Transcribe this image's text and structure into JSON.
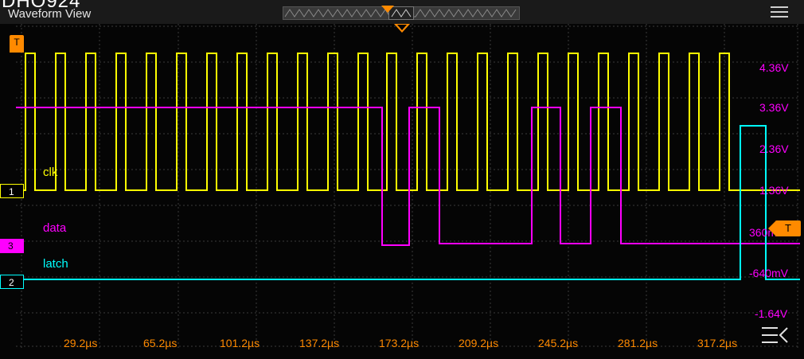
{
  "window": {
    "model": "DHO924",
    "title": "Waveform View"
  },
  "channels": {
    "ch1": {
      "number": "1",
      "label": "clk",
      "color": "#ffff00"
    },
    "ch3": {
      "number": "3",
      "label": "data",
      "color": "#ff00ff"
    },
    "ch2": {
      "number": "2",
      "label": "latch",
      "color": "#00ffff"
    }
  },
  "trigger": {
    "tag": "T",
    "level_tag": "T",
    "color": "#ff8a00"
  },
  "vertical_scale": [
    "4.36V",
    "3.36V",
    "2.36V",
    "1.36V",
    "360mV",
    "-640mV",
    "-1.64V"
  ],
  "time_scale": [
    "29.2µs",
    "65.2µs",
    "101.2µs",
    "137.2µs",
    "173.2µs",
    "209.2µs",
    "245.2µs",
    "281.2µs",
    "317.2µs"
  ],
  "icons": {
    "menu": "hamburger-menu-icon",
    "collapse": "collapse-panel-icon"
  }
}
